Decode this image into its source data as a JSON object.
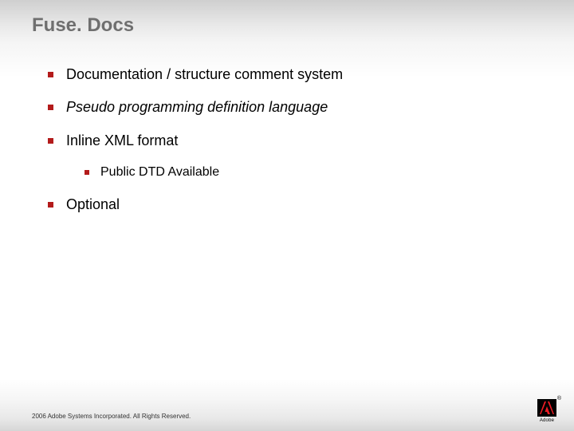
{
  "title": "Fuse. Docs",
  "bullets": [
    {
      "text": "Documentation / structure comment system",
      "italic": false
    },
    {
      "text": "Pseudo programming definition language",
      "italic": true
    },
    {
      "text": "Inline XML format",
      "italic": false,
      "children": [
        {
          "text": "Public DTD Available",
          "italic": false
        }
      ]
    },
    {
      "text": "Optional",
      "italic": false
    }
  ],
  "footer": "2006 Adobe Systems Incorporated. All Rights Reserved.",
  "logo": {
    "label": "Adobe",
    "registered": "®"
  }
}
